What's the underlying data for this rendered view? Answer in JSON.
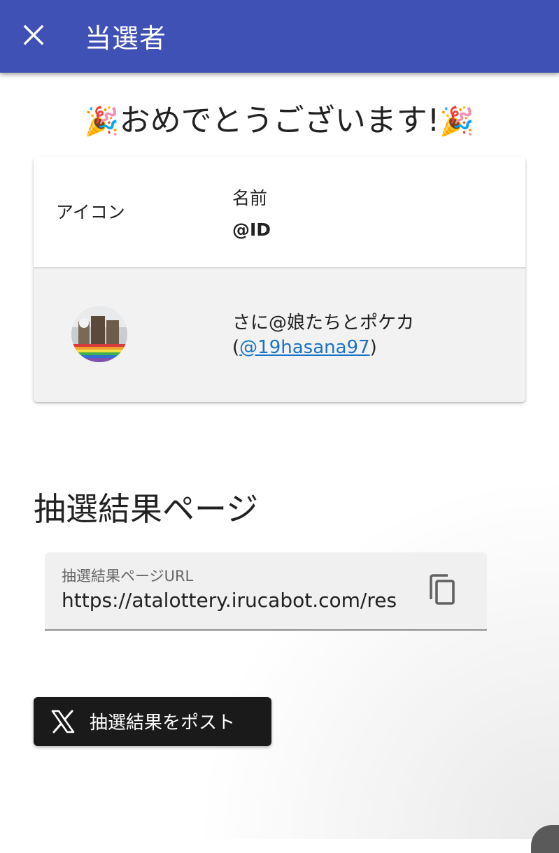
{
  "appbar": {
    "title": "当選者",
    "close_icon": "close-icon"
  },
  "congrats": {
    "emoji_left": "🎉",
    "text": "おめでとうございます!",
    "emoji_right": "🎉"
  },
  "table": {
    "headers": {
      "icon": "アイコン",
      "name": "名前",
      "id": "@ID"
    },
    "rows": [
      {
        "avatar_icon": "avatar-image",
        "name": "さに@娘たちとポケカ",
        "id_open": "(",
        "id": "@19hasana97",
        "id_close": ")"
      }
    ]
  },
  "results_section": {
    "title": "抽選結果ページ",
    "url_field": {
      "label": "抽選結果ページURL",
      "value": "https://atalottery.irucabot.com/res",
      "copy_icon": "copy-icon"
    }
  },
  "post_button": {
    "icon": "x-logo-icon",
    "label": "抽選結果をポスト"
  },
  "colors": {
    "appbar": "#3f51b5",
    "link": "#1a73c7",
    "post_button": "#1a1a1a"
  }
}
